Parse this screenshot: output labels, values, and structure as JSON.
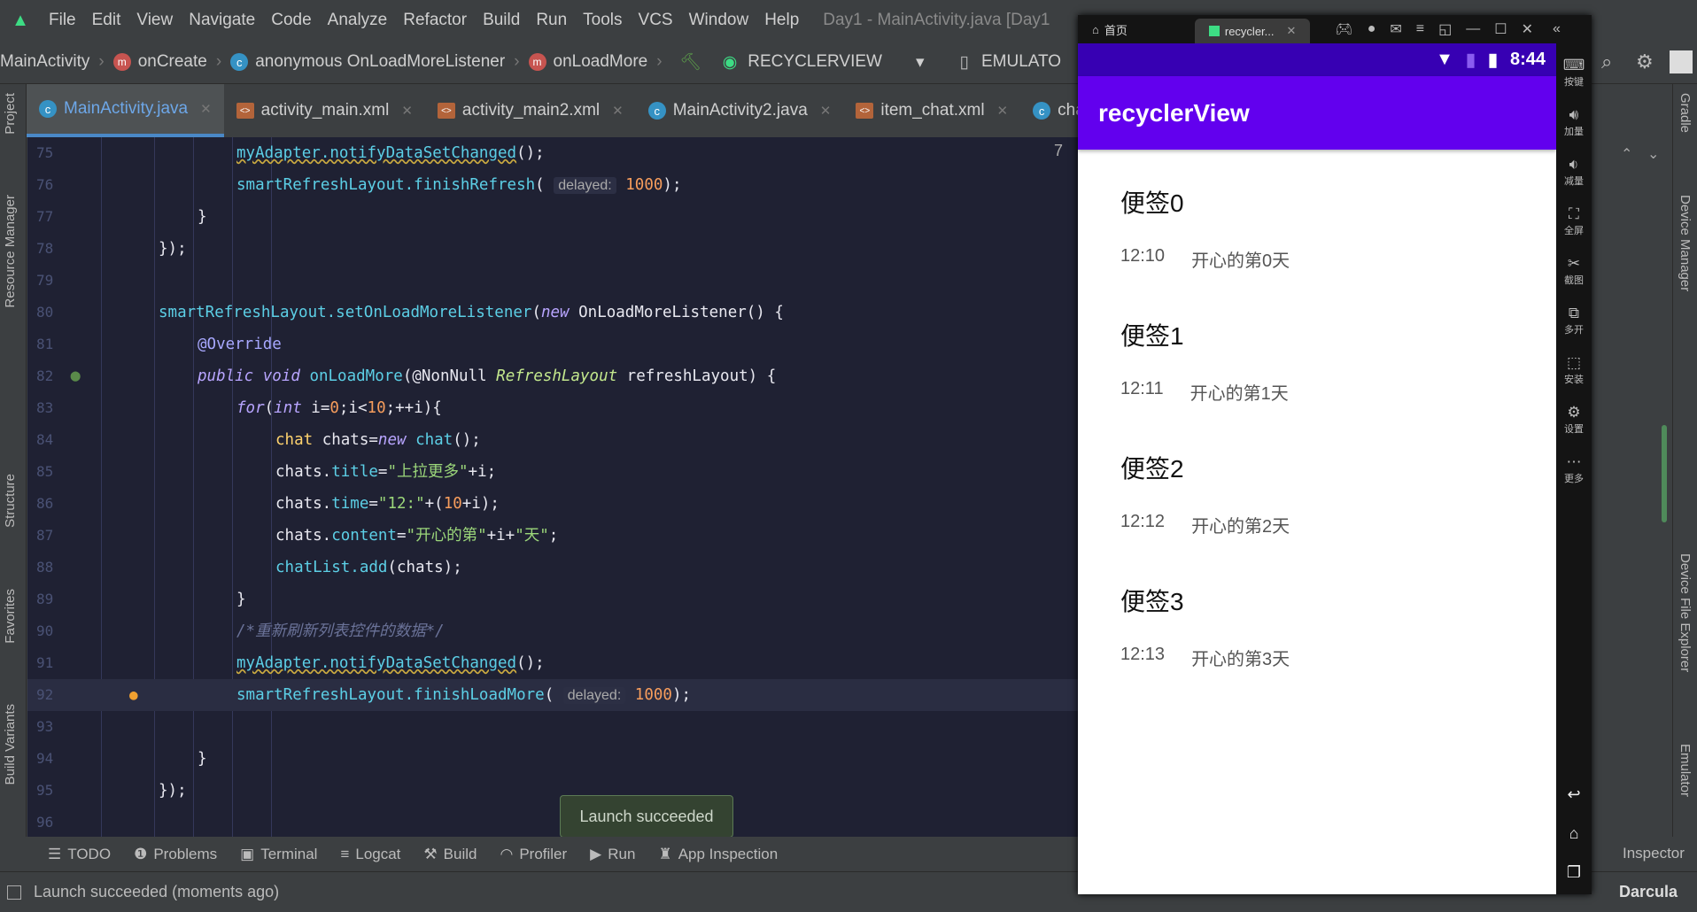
{
  "menu": {
    "items": [
      "File",
      "Edit",
      "View",
      "Navigate",
      "Code",
      "Analyze",
      "Refactor",
      "Build",
      "Run",
      "Tools",
      "VCS",
      "Window",
      "Help"
    ],
    "title": "Day1 - MainActivity.java [Day1"
  },
  "breadcrumbs": {
    "items": [
      "MainActivity",
      "onCreate",
      "anonymous OnLoadMoreListener",
      "onLoadMore"
    ],
    "run_config": "RECYCLERVIEW",
    "device": "EMULATO"
  },
  "tabs": [
    {
      "label": "MainActivity.java",
      "type": "java",
      "active": true
    },
    {
      "label": "activity_main.xml",
      "type": "xml"
    },
    {
      "label": "activity_main2.xml",
      "type": "xml"
    },
    {
      "label": "MainActivity2.java",
      "type": "java"
    },
    {
      "label": "item_chat.xml",
      "type": "xml"
    },
    {
      "label": "chat",
      "type": "java"
    }
  ],
  "left_tools": [
    "Project",
    "Resource Manager",
    "Structure",
    "Favorites",
    "Build Variants"
  ],
  "right_tools": [
    "Gradle",
    "Device Manager",
    "Device File Explorer",
    "Emulator"
  ],
  "editor": {
    "current_line": 92,
    "find_count": "7",
    "lines": [
      {
        "n": "75",
        "indent": 6,
        "t": [
          [
            "myAdapter.notifyDataSetChanged",
            "fn wavy"
          ],
          [
            "();",
            "pl"
          ]
        ]
      },
      {
        "n": "76",
        "indent": 6,
        "t": [
          [
            "smartRefreshLayout.finishRefresh",
            "fn"
          ],
          [
            "( ",
            "pl"
          ],
          [
            "delayed:",
            "hint"
          ],
          [
            " 1000",
            "nu"
          ],
          [
            ");",
            "pl"
          ]
        ]
      },
      {
        "n": "77",
        "indent": 5,
        "t": [
          [
            "}",
            "pl"
          ]
        ]
      },
      {
        "n": "78",
        "indent": 4,
        "t": [
          [
            "});",
            "pl"
          ]
        ]
      },
      {
        "n": "79",
        "indent": 4,
        "t": []
      },
      {
        "n": "80",
        "indent": 4,
        "t": [
          [
            "smartRefreshLayout.setOnLoadMoreListener",
            "fn"
          ],
          [
            "(",
            "pl"
          ],
          [
            "new",
            "kw"
          ],
          [
            " OnLoadMoreListener() {",
            "pl"
          ]
        ]
      },
      {
        "n": "81",
        "indent": 5,
        "t": [
          [
            "@Override",
            "an"
          ]
        ]
      },
      {
        "n": "82",
        "indent": 5,
        "t": [
          [
            "public void",
            "kw"
          ],
          [
            " onLoadMore",
            "fn"
          ],
          [
            "(@NonNull ",
            "pl"
          ],
          [
            "RefreshLayout",
            "it"
          ],
          [
            " refreshLayout) {",
            "pl"
          ]
        ]
      },
      {
        "n": "83",
        "indent": 6,
        "t": [
          [
            "for",
            "kw"
          ],
          [
            "(",
            "pl"
          ],
          [
            "int",
            "kw"
          ],
          [
            " i=",
            "pl"
          ],
          [
            "0",
            "nu"
          ],
          [
            ";i<",
            "pl"
          ],
          [
            "10",
            "nu"
          ],
          [
            ";++i){",
            "pl"
          ]
        ]
      },
      {
        "n": "84",
        "indent": 7,
        "t": [
          [
            "chat",
            "ty"
          ],
          [
            " chats=",
            "pl"
          ],
          [
            "new",
            "kw"
          ],
          [
            " chat",
            "fn"
          ],
          [
            "();",
            "pl"
          ]
        ]
      },
      {
        "n": "85",
        "indent": 7,
        "t": [
          [
            "chats.",
            "pl"
          ],
          [
            "title",
            "fn"
          ],
          [
            "=",
            "pl"
          ],
          [
            "\"上拉更多\"",
            "st"
          ],
          [
            "+i;",
            "pl"
          ]
        ]
      },
      {
        "n": "86",
        "indent": 7,
        "t": [
          [
            "chats.",
            "pl"
          ],
          [
            "time",
            "fn"
          ],
          [
            "=",
            "pl"
          ],
          [
            "\"12:\"",
            "st"
          ],
          [
            "+(",
            "pl"
          ],
          [
            "10",
            "nu"
          ],
          [
            "+i);",
            "pl"
          ]
        ]
      },
      {
        "n": "87",
        "indent": 7,
        "t": [
          [
            "chats.",
            "pl"
          ],
          [
            "content",
            "fn"
          ],
          [
            "=",
            "pl"
          ],
          [
            "\"开心的第\"",
            "st"
          ],
          [
            "+i+",
            "pl"
          ],
          [
            "\"天\"",
            "st"
          ],
          [
            ";",
            "pl"
          ]
        ]
      },
      {
        "n": "88",
        "indent": 7,
        "t": [
          [
            "chatList.add",
            "fn"
          ],
          [
            "(chats);",
            "pl"
          ]
        ]
      },
      {
        "n": "89",
        "indent": 6,
        "t": [
          [
            "}",
            "pl"
          ]
        ]
      },
      {
        "n": "90",
        "indent": 6,
        "t": [
          [
            "/*重新刷新列表控件的数据*/",
            "cm"
          ]
        ]
      },
      {
        "n": "91",
        "indent": 6,
        "t": [
          [
            "myAdapter.notifyDataSetChanged",
            "fn wavy"
          ],
          [
            "();",
            "pl"
          ]
        ]
      },
      {
        "n": "92",
        "indent": 6,
        "t": [
          [
            "smartRefreshLayout.finishLoadMore",
            "fn"
          ],
          [
            "( ",
            "pl"
          ],
          [
            "delayed:",
            "hint"
          ],
          [
            " 1000",
            "nu"
          ],
          [
            ");",
            "pl"
          ]
        ]
      },
      {
        "n": "93",
        "indent": 5,
        "t": []
      },
      {
        "n": "94",
        "indent": 5,
        "t": [
          [
            "}",
            "pl"
          ]
        ]
      },
      {
        "n": "95",
        "indent": 4,
        "t": [
          [
            "});",
            "pl"
          ]
        ]
      },
      {
        "n": "96",
        "indent": 4,
        "t": []
      }
    ]
  },
  "toast": "Launch succeeded",
  "tool_windows": [
    "TODO",
    "Problems",
    "Terminal",
    "Logcat",
    "Build",
    "Profiler",
    "Run",
    "App Inspection"
  ],
  "layout_inspector": "Inspector",
  "status": {
    "message": "Launch succeeded (moments ago)",
    "theme": "Darcula"
  },
  "emulator": {
    "tabs": [
      "首页",
      "recycler..."
    ],
    "time": "8:44",
    "app_title": "recyclerView",
    "side_buttons": [
      "按键",
      "加量",
      "减量",
      "全屏",
      "截图",
      "多开",
      "安装",
      "设置",
      "更多"
    ],
    "items": [
      {
        "title": "便签0",
        "time": "12:10",
        "content": "开心的第0天"
      },
      {
        "title": "便签1",
        "time": "12:11",
        "content": "开心的第1天"
      },
      {
        "title": "便签2",
        "time": "12:12",
        "content": "开心的第2天"
      },
      {
        "title": "便签3",
        "time": "12:13",
        "content": "开心的第3天"
      }
    ]
  },
  "colors": {
    "app_bar": "#6200ee",
    "status_bar": "#3700b3",
    "editor_bg": "#1f2133"
  }
}
